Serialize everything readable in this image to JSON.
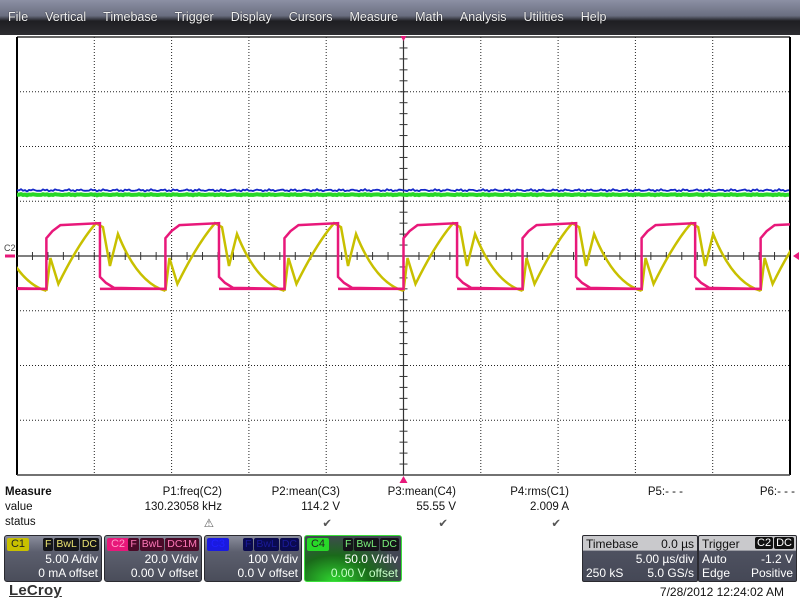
{
  "menu": [
    "File",
    "Vertical",
    "Timebase",
    "Trigger",
    "Display",
    "Cursors",
    "Measure",
    "Math",
    "Analysis",
    "Utilities",
    "Help"
  ],
  "grid": {
    "h_divisions": 10,
    "v_divisions": 8,
    "trigger_marker_label": "C2",
    "colors": {
      "C1": "#c8c000",
      "C2": "#e8187a",
      "C3": "#1428c8",
      "C4": "#28d828"
    }
  },
  "waveforms": {
    "C2_period_divisions": 1.54,
    "C2_high_div": 0.6,
    "C2_low_div": -0.6,
    "C3_level_div": 1.2,
    "C4_level_div": 1.12,
    "first_rise_div": 0.38
  },
  "measure": {
    "title": "Measure",
    "row_value_label": "value",
    "row_status_label": "status",
    "params": [
      {
        "name": "P1:freq(C2)",
        "value": "130.23058 kHz",
        "status": "warning"
      },
      {
        "name": "P2:mean(C3)",
        "value": "114.2 V",
        "status": "ok"
      },
      {
        "name": "P3:mean(C4)",
        "value": "55.55 V",
        "status": "ok"
      },
      {
        "name": "P4:rms(C1)",
        "value": "2.009 A",
        "status": "ok"
      },
      {
        "name": "P5:- - -",
        "value": "",
        "status": ""
      },
      {
        "name": "P6:- - -",
        "value": "",
        "status": ""
      }
    ],
    "status_glyphs": {
      "warning": "⚠",
      "ok": "✔"
    }
  },
  "channels": [
    {
      "id": "C1",
      "flags": [
        "F",
        "BwL",
        "DC"
      ],
      "vdiv": "5.00 A/div",
      "offset": "0 mA offset",
      "color": "#c8c000",
      "text": "#222"
    },
    {
      "id": "C2",
      "flags": [
        "F",
        "BwL",
        "DC1M"
      ],
      "vdiv": "20.0 V/div",
      "offset": "0.00 V offset",
      "color": "#e8187a",
      "text": "#ff9ac8"
    },
    {
      "id": "C3",
      "flags": [
        "F",
        "BwL",
        "DC"
      ],
      "vdiv": "100 V/div",
      "offset": "0.0 V offset",
      "color": "#1a1ae0",
      "text": "#2020ff"
    },
    {
      "id": "C4",
      "flags": [
        "F",
        "BwL",
        "DC"
      ],
      "vdiv": "50.0 V/div",
      "offset": "0.00 V offset",
      "color": "#28d828",
      "text": "#222"
    }
  ],
  "timebase": {
    "title": "Timebase",
    "delay": "0.0 µs",
    "tdiv": "5.00 µs/div",
    "samples": "250 kS",
    "rate": "5.0 GS/s"
  },
  "trigger": {
    "title": "Trigger",
    "source": "C2",
    "coupling": "DC",
    "mode": "Auto",
    "level": "-1.2 V",
    "type": "Edge",
    "slope": "Positive"
  },
  "footer": {
    "datetime": "7/28/2012 12:24:02 AM",
    "logo": "LeCroy"
  }
}
